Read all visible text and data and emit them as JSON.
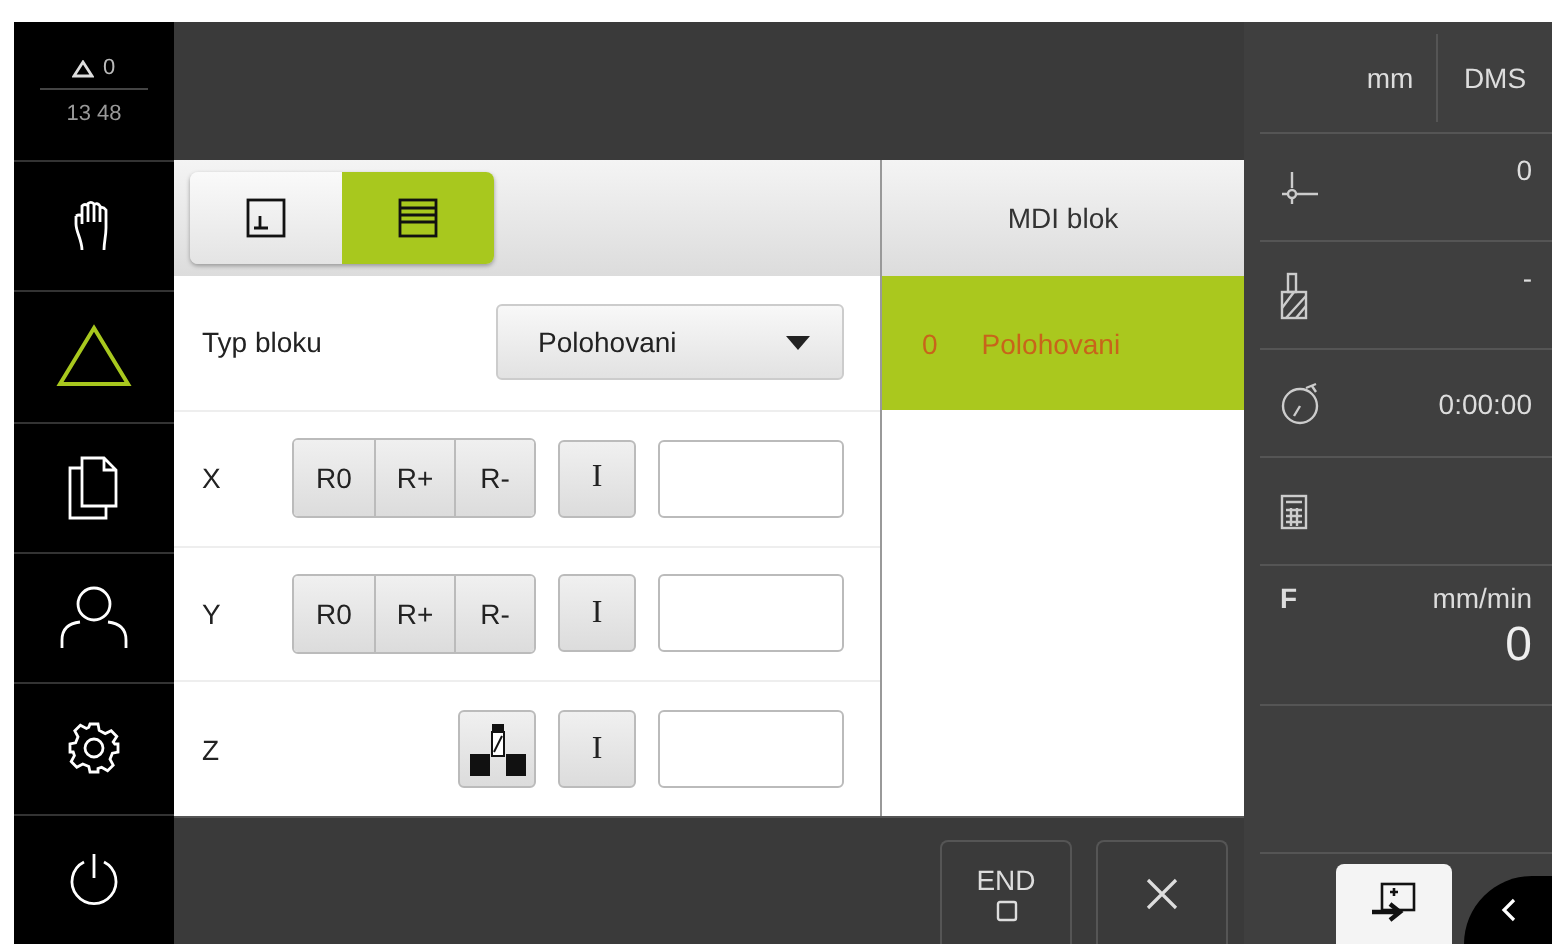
{
  "status": {
    "warnings": "0",
    "time": "13 48"
  },
  "sidebar": {
    "items": [
      {
        "kind": "manual",
        "selected": false
      },
      {
        "kind": "mdi",
        "selected": true
      },
      {
        "kind": "files",
        "selected": false
      },
      {
        "kind": "user",
        "selected": false
      },
      {
        "kind": "settings",
        "selected": false
      },
      {
        "kind": "power",
        "selected": false
      }
    ]
  },
  "view_toggles": [
    {
      "kind": "sketch",
      "selected": false
    },
    {
      "kind": "list",
      "selected": true
    }
  ],
  "block_type": {
    "label": "Typ bloku",
    "value": "Polohovani"
  },
  "axes": [
    {
      "label": "X",
      "kind": "reference",
      "buttons": [
        "R0",
        "R+",
        "R-"
      ],
      "increment": "I"
    },
    {
      "label": "Y",
      "kind": "reference",
      "buttons": [
        "R0",
        "R+",
        "R-"
      ],
      "increment": "I"
    },
    {
      "label": "Z",
      "kind": "probe",
      "increment": "I"
    }
  ],
  "mdi_list": {
    "title": "MDI blok",
    "rows": [
      {
        "number": "0",
        "name": "Polohovani",
        "selected": true
      }
    ]
  },
  "bottom_bar": {
    "end_label": "END"
  },
  "units": [
    "mm",
    "DMS"
  ],
  "info_rows": [
    {
      "kind": "datum",
      "value": "0"
    },
    {
      "kind": "tool",
      "value": "-"
    },
    {
      "kind": "timer",
      "value": "0:00:00"
    },
    {
      "kind": "calculator"
    }
  ],
  "feed": {
    "label": "F",
    "unit": "mm/min",
    "value": "0"
  }
}
